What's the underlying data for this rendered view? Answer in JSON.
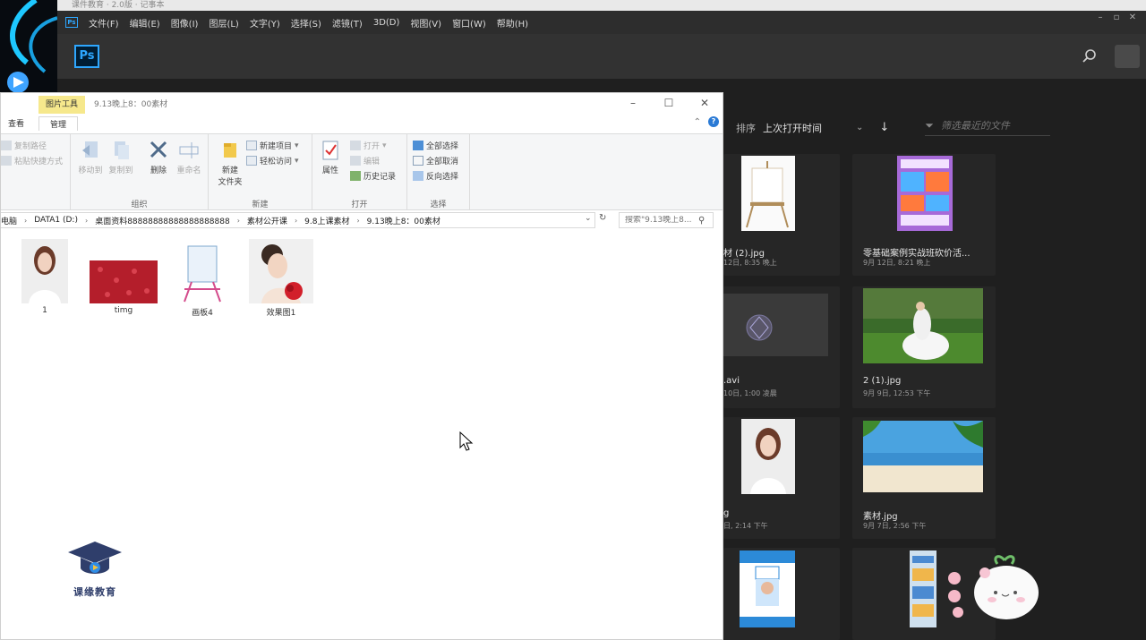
{
  "background_window": {
    "title": "课件教育 · 2.0版 · 记事本"
  },
  "photoshop": {
    "app_badge": "Ps",
    "menu": [
      "文件(F)",
      "编辑(E)",
      "图像(I)",
      "图层(L)",
      "文字(Y)",
      "选择(S)",
      "滤镜(T)",
      "3D(D)",
      "视图(V)",
      "窗口(W)",
      "帮助(H)"
    ],
    "logo": "Ps",
    "sort_label": "排序",
    "sort_value": "上次打开时间",
    "filter_placeholder": "筛选最近的文件",
    "cards": [
      {
        "name": "材 (2).jpg",
        "date": "12日, 8:35 晚上"
      },
      {
        "name": "零基础案例实战班砍价活...",
        "date": "9月 12日, 8:21 晚上"
      },
      {
        "name": ".avi",
        "date": "10日, 1:00 凌晨"
      },
      {
        "name": "2 (1).jpg",
        "date": "9月 9日, 12:53 下午"
      },
      {
        "name": "g",
        "date": "日, 2:14 下午"
      },
      {
        "name": "素材.jpg",
        "date": "9月 7日, 2:56 下午"
      },
      {
        "name": "",
        "date": ""
      },
      {
        "name": "",
        "date": ""
      }
    ],
    "colors": {
      "accent": "#2ea7ff",
      "bg": "#1f1f1f"
    }
  },
  "explorer": {
    "context_tab": "图片工具",
    "title": "9.13晚上8：00素材",
    "ribbon_tabs": {
      "view": "查看",
      "manage": "管理"
    },
    "clipboard": {
      "copy_path": "复制路径",
      "paste_shortcut": "粘贴快捷方式"
    },
    "organize": {
      "move_to": "移动到",
      "copy_to": "复制到",
      "delete": "删除",
      "rename": "重命名",
      "label": "组织"
    },
    "new": {
      "new_folder": "新建\n文件夹",
      "new_item": "新建项目",
      "easy_access": "轻松访问",
      "label": "新建"
    },
    "open": {
      "properties": "属性",
      "open": "打开",
      "edit": "编辑",
      "history": "历史记录",
      "label": "打开"
    },
    "select": {
      "select_all": "全部选择",
      "select_none": "全部取消",
      "invert": "反向选择",
      "label": "选择"
    },
    "address": [
      "电脑",
      "DATA1 (D:)",
      "桌面资料88888888888888888888",
      "素材公开课",
      "9.8上课素材",
      "9.13晚上8：00素材"
    ],
    "search_placeholder": "搜索\"9.13晚上8...",
    "files": [
      {
        "name": "1"
      },
      {
        "name": "timg"
      },
      {
        "name": "画板4"
      },
      {
        "name": "效果图1"
      }
    ]
  },
  "watermark": {
    "text": "课缘教育"
  }
}
